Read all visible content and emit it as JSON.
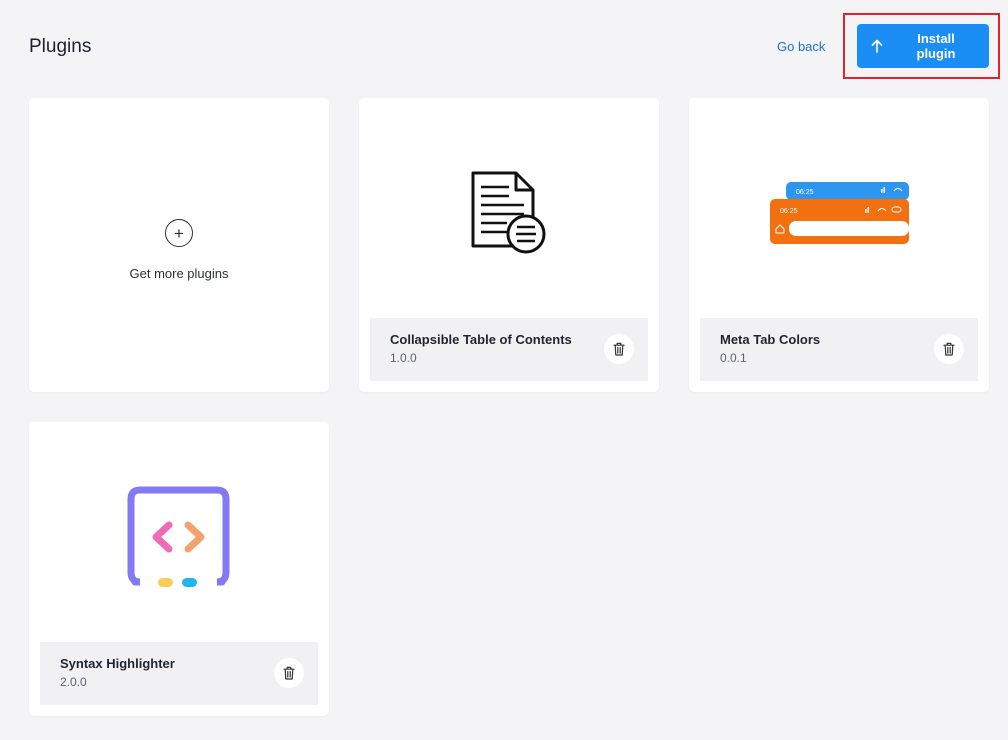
{
  "header": {
    "title": "Plugins",
    "go_back_label": "Go back",
    "install_label": "Install plugin"
  },
  "get_more": {
    "label": "Get more plugins"
  },
  "plugins": [
    {
      "name": "Collapsible Table of Contents",
      "version": "1.0.0",
      "icon": "document-list-icon"
    },
    {
      "name": "Meta Tab Colors",
      "version": "0.0.1",
      "icon": "phone-statusbar-preview"
    },
    {
      "name": "Syntax Highlighter",
      "version": "2.0.0",
      "icon": "code-brackets-icon"
    }
  ],
  "meta_preview": {
    "time_blue": "06:25",
    "time_orange": "06:25"
  },
  "colors": {
    "accent": "#1a8ef5",
    "highlight_border": "#e0242a",
    "status_blue": "#2d97f0",
    "status_orange": "#f2700f"
  }
}
